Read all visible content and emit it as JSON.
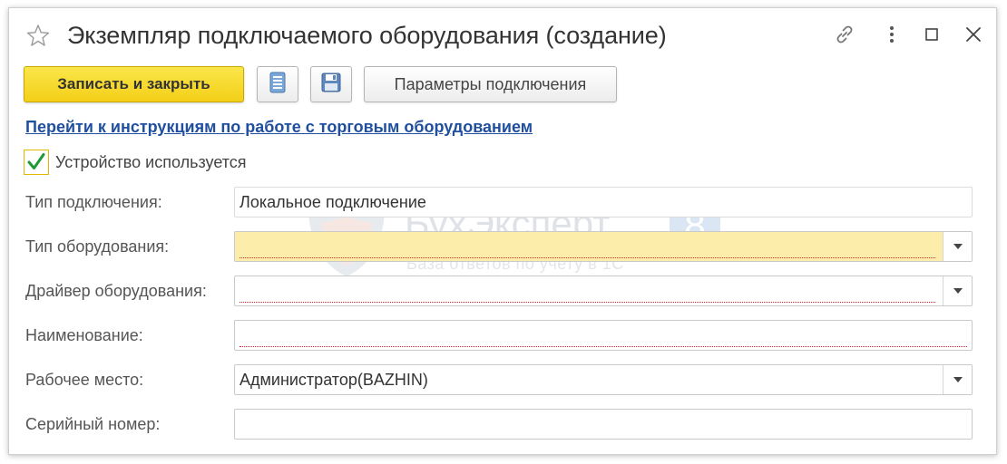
{
  "window": {
    "title": "Экземпляр подключаемого оборудования (создание)"
  },
  "toolbar": {
    "save_close_label": "Записать и закрыть",
    "params_label": "Параметры подключения",
    "accent_color": "#f5d72a"
  },
  "help_link": "Перейти к инструкциям по работе с торговым оборудованием",
  "device_used": {
    "label": "Устройство используется",
    "checked": true
  },
  "fields": {
    "connection_type": {
      "label": "Тип подключения:",
      "value": "Локальное подключение"
    },
    "equipment_type": {
      "label": "Тип оборудования:",
      "value": ""
    },
    "driver": {
      "label": "Драйвер оборудования:",
      "value": ""
    },
    "name": {
      "label": "Наименование:",
      "value": ""
    },
    "workplace": {
      "label": "Рабочее место:",
      "value": "Администратор(BAZHIN)"
    },
    "serial": {
      "label": "Серийный номер:",
      "value": ""
    }
  },
  "watermark": {
    "brand": "БухЭксперт",
    "badge": "8",
    "tagline": "База ответов по учету в 1С"
  }
}
